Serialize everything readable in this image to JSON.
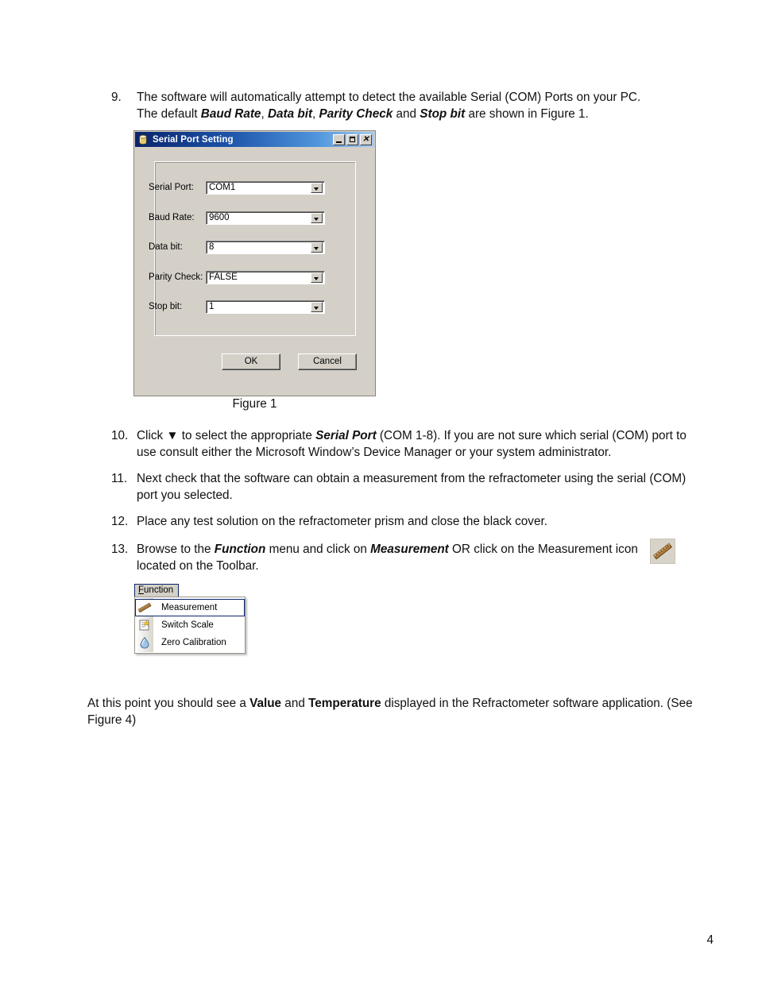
{
  "document": {
    "page_number": "4",
    "figure_caption": "Figure 1",
    "steps": [
      {
        "number": "9.",
        "text_parts": [
          {
            "t": "The software will automatically attempt to detect the available Serial (COM) Ports on your PC. The default ",
            "s": "normal"
          },
          {
            "t": "Baud Rate",
            "s": "bold-italic"
          },
          {
            "t": ", ",
            "s": "normal"
          },
          {
            "t": "Data bit",
            "s": "bold-italic"
          },
          {
            "t": ", ",
            "s": "normal"
          },
          {
            "t": "Parity Check",
            "s": "bold-italic"
          },
          {
            "t": " and ",
            "s": "normal"
          },
          {
            "t": "Stop bit",
            "s": "bold-italic"
          },
          {
            "t": " are shown in Figure 1.",
            "s": "normal"
          }
        ]
      },
      {
        "number": "10.",
        "text_parts": [
          {
            "t": "Click ",
            "s": "normal"
          },
          {
            "t": "▼",
            "s": "normal"
          },
          {
            "t": " to select the appropriate ",
            "s": "normal"
          },
          {
            "t": "Serial Port",
            "s": "bold-italic"
          },
          {
            "t": " (COM 1-8). If you are not sure which serial (COM) port to use consult either the Microsoft Window’s Device Manager or your system administrator.",
            "s": "normal"
          }
        ]
      },
      {
        "number": "11.",
        "text_parts": [
          {
            "t": "Next check that the software can obtain a measurement from the refractometer using the serial (COM) port you selected.",
            "s": "normal"
          }
        ]
      },
      {
        "number": "12.",
        "text_parts": [
          {
            "t": "Place any test solution on the refractometer prism and close the black cover.",
            "s": "normal"
          }
        ]
      },
      {
        "number": "13.",
        "text_parts": [
          {
            "t": "Browse to the ",
            "s": "normal"
          },
          {
            "t": "Function",
            "s": "bold-italic"
          },
          {
            "t": " menu and click on ",
            "s": "normal"
          },
          {
            "t": "Measurement",
            "s": "bold-italic"
          },
          {
            "t": " OR click on the Measurement icon",
            "s": "normal"
          },
          {
            "t": " located on the Toolbar.",
            "s": "normal"
          }
        ]
      }
    ],
    "closing_paragraph_parts": [
      {
        "t": "At this point you should see a ",
        "s": "normal"
      },
      {
        "t": "Value",
        "s": "bold"
      },
      {
        "t": " and ",
        "s": "normal"
      },
      {
        "t": "Temperature",
        "s": "bold"
      },
      {
        "t": " displayed in the Refractometer software application. (See Figure 4)",
        "s": "normal"
      }
    ]
  },
  "toolbar_icon": {
    "name": "measurement-ruler-icon",
    "color": "#9b6a33",
    "background": "#d8d3c8"
  },
  "dialog": {
    "title": "Serial Port Setting",
    "title_icon": "cylinder-database-icon",
    "title_bar_colors": {
      "left": "#0a246a",
      "right": "#a6caf0"
    },
    "window_buttons": [
      {
        "name": "minimize",
        "glyph": "_"
      },
      {
        "name": "maximize",
        "glyph": "□"
      },
      {
        "name": "close",
        "glyph": "×"
      }
    ],
    "fields": [
      {
        "label": "Serial Port:",
        "value": "COM1",
        "name": "serial-port"
      },
      {
        "label": "Baud Rate:",
        "value": "9600",
        "name": "baud-rate"
      },
      {
        "label": "Data bit:",
        "value": "8",
        "name": "data-bit"
      },
      {
        "label": "Parity Check:",
        "value": "FALSE",
        "name": "parity-check"
      },
      {
        "label": "Stop bit:",
        "value": "1",
        "name": "stop-bit"
      }
    ],
    "buttons": {
      "ok": "OK",
      "cancel": "Cancel"
    }
  },
  "function_menu": {
    "title": "Function",
    "title_accesskey": "F",
    "title_rest": "unction",
    "items": [
      {
        "label": "Measurement",
        "icon": "ruler-icon",
        "selected": true
      },
      {
        "label": "Switch Scale",
        "icon": "switch-scale-icon",
        "selected": false
      },
      {
        "label": "Zero Calibration",
        "icon": "water-droplet-icon",
        "selected": false
      }
    ]
  }
}
